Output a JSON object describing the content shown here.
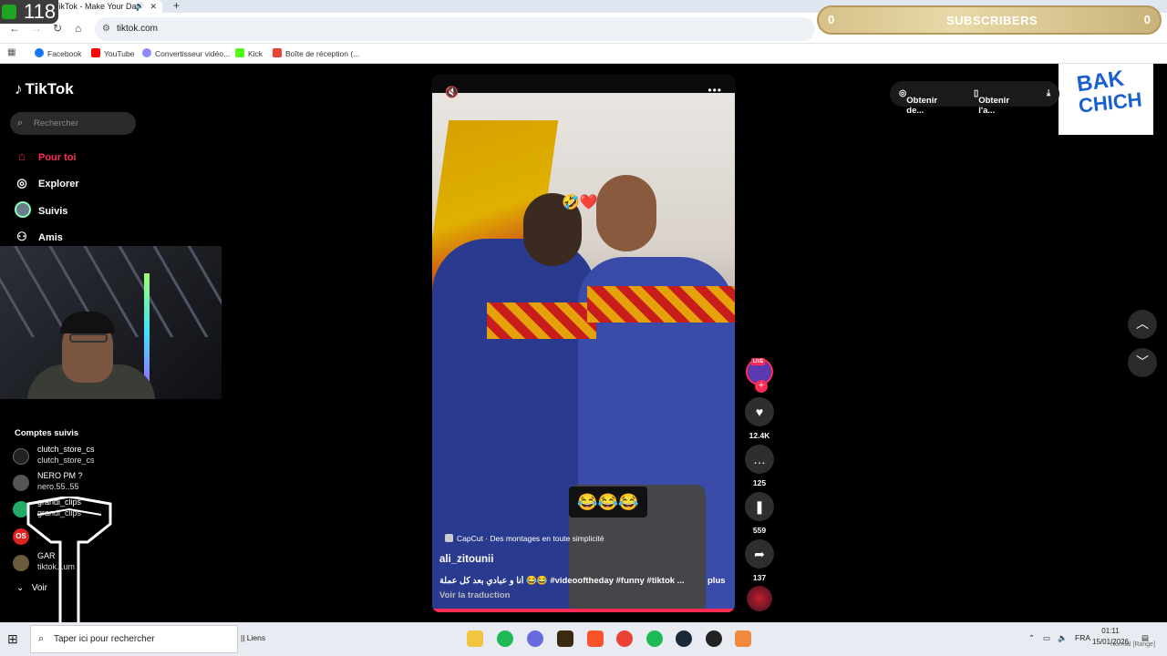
{
  "browser": {
    "tab_title": "(1) TikTok - Make Your Day",
    "url": "tiktok.com",
    "bookmarks": [
      {
        "label": "Facebook",
        "color": "#1877f2"
      },
      {
        "label": "YouTube",
        "color": "#ff0000"
      },
      {
        "label": "Convertisseur vidéo...",
        "color": "#8a8aff"
      },
      {
        "label": "Kick",
        "color": "#53fc18"
      },
      {
        "label": "Boîte de réception (...",
        "color": "#ea4335"
      }
    ]
  },
  "overlay": {
    "counter": "118",
    "subscribers_left": "0",
    "subscribers_label": "SUBSCRIBERS",
    "subscribers_right": "0",
    "brand_line1": "BAK",
    "brand_line2": "CHICH"
  },
  "sidebar": {
    "logo": "TikTok",
    "search_placeholder": "Rechercher",
    "nav": [
      {
        "label": "Pour toi",
        "icon": "home-icon"
      },
      {
        "label": "Explorer",
        "icon": "compass-icon"
      },
      {
        "label": "Suivis",
        "icon": "avatar"
      },
      {
        "label": "Amis",
        "icon": "friends-icon"
      }
    ],
    "followed_title": "Comptes suivis",
    "accounts": [
      {
        "name": "clutch_store_cs",
        "user": "clutch_store_cs"
      },
      {
        "name": "NERO PM ?",
        "user": "nero.55..55"
      },
      {
        "name": "grandi_clips",
        "user": "grandi_clips"
      },
      {
        "name": "",
        "user": ""
      },
      {
        "name": "GAR",
        "user": "tiktok...um"
      }
    ],
    "voir_plus": "Voir"
  },
  "video": {
    "capcut": "CapCut · Des montages en toute simplicité",
    "author": "ali_zitounii",
    "caption": "أنا و عبادي بعد كل عملة 😂😂 #videooftheday #funny #tiktok ...",
    "more": "plus",
    "translate": "Voir la traduction",
    "emoji_overlay": "😂😂😂",
    "reaction": "🤣❤️"
  },
  "actions": {
    "live": "LIVE",
    "likes": "12.4K",
    "comments": "125",
    "saves": "559",
    "shares": "137"
  },
  "top_right": {
    "btn1": "Obtenir de...",
    "btn2": "Obtenir l'a..."
  },
  "taskbar": {
    "search_placeholder": "Taper ici pour rechercher",
    "links": "Liens",
    "lang": "FRA",
    "time": "01:11",
    "date": "15/01/2026",
    "watermark": "Normal [Range]"
  }
}
